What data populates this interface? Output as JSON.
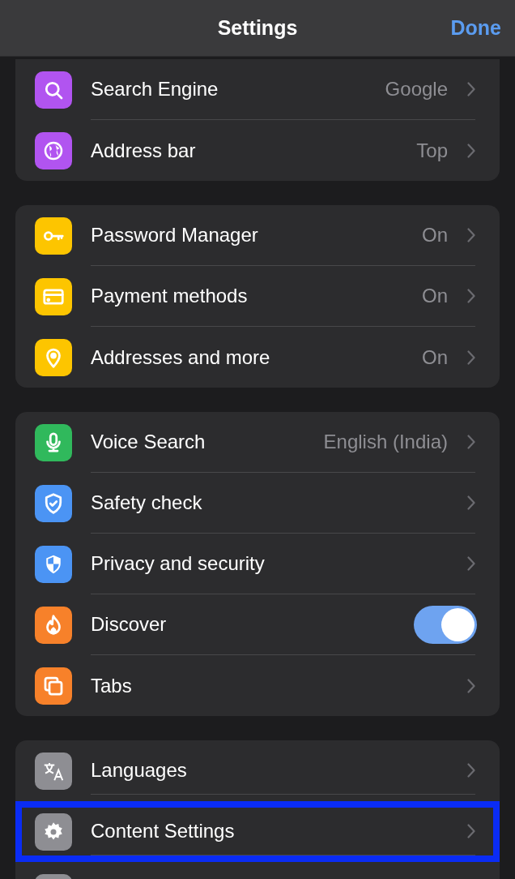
{
  "header": {
    "title": "Settings",
    "done": "Done"
  },
  "groups": [
    {
      "items": [
        {
          "kind": "link",
          "label": "Search Engine",
          "value": "Google",
          "color": "#b154f0"
        },
        {
          "kind": "link",
          "label": "Address bar",
          "value": "Top",
          "color": "#b154f0"
        }
      ]
    },
    {
      "items": [
        {
          "kind": "link",
          "label": "Password Manager",
          "value": "On",
          "color": "#fdc500"
        },
        {
          "kind": "link",
          "label": "Payment methods",
          "value": "On",
          "color": "#fdc500"
        },
        {
          "kind": "link",
          "label": "Addresses and more",
          "value": "On",
          "color": "#fdc500"
        }
      ]
    },
    {
      "items": [
        {
          "kind": "link",
          "label": "Voice Search",
          "value": "English (India)",
          "color": "#30b95c"
        },
        {
          "kind": "link",
          "label": "Safety check",
          "color": "#4b94f4"
        },
        {
          "kind": "link",
          "label": "Privacy and security",
          "color": "#4b94f4"
        },
        {
          "kind": "toggle",
          "label": "Discover",
          "on": true,
          "color": "#f7812a"
        },
        {
          "kind": "link",
          "label": "Tabs",
          "color": "#f7812a"
        }
      ]
    },
    {
      "items": [
        {
          "kind": "link",
          "label": "Languages",
          "color": "#8e8e93",
          "highlighted": false
        },
        {
          "kind": "link",
          "label": "Content Settings",
          "color": "#8e8e93",
          "highlighted": true
        },
        {
          "kind": "cut",
          "color": "#8e8e93"
        }
      ]
    }
  ]
}
